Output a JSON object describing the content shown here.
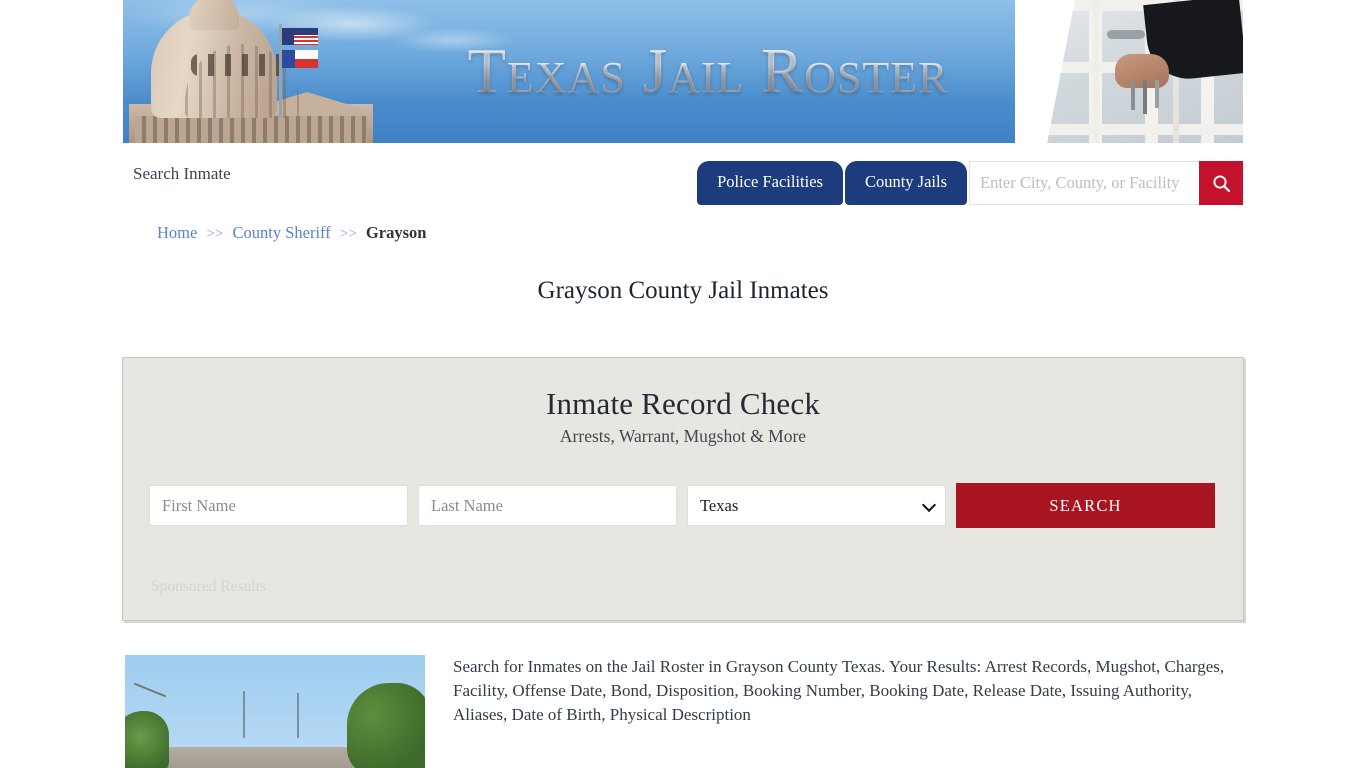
{
  "banner": {
    "title": "Texas Jail Roster",
    "left_image_alt": "texas-capitol-dome",
    "right_image_alt": "jail-cell-door-with-keys"
  },
  "nav": {
    "search_inmate_label": "Search Inmate",
    "tabs": [
      {
        "label": "Police Facilities"
      },
      {
        "label": "County Jails"
      }
    ],
    "search": {
      "value": "",
      "placeholder": "Enter City, County, or Facility",
      "button_icon": "search-icon"
    }
  },
  "breadcrumb": {
    "items": [
      {
        "label": "Home",
        "link": true
      },
      {
        "label": "County Sheriff",
        "link": true
      },
      {
        "label": "Grayson",
        "link": false
      }
    ],
    "separator": ">>"
  },
  "page_title": "Grayson County Jail Inmates",
  "record_check": {
    "heading": "Inmate Record Check",
    "subheading": "Arrests, Warrant, Mugshot & More",
    "first_name": {
      "value": "",
      "placeholder": "First Name"
    },
    "last_name": {
      "value": "",
      "placeholder": "Last Name"
    },
    "state_select": {
      "selected": "Texas",
      "options": [
        "Texas"
      ]
    },
    "search_button": "SEARCH",
    "sponsored_label": "Sponsored Results"
  },
  "content": {
    "thumbnail_alt": "grayson-county-jail-building",
    "description": "Search for Inmates on the Jail Roster in Grayson County Texas. Your Results: Arrest Records, Mugshot, Charges, Facility, Offense Date, Bond, Disposition, Booking Number, Booking Date, Release Date, Issuing Authority, Aliases, Date of Birth, Physical Description"
  },
  "colors": {
    "tab_blue": "#1d3c7e",
    "search_red": "#c4122c",
    "button_red": "#a81520",
    "panel_bg": "#e7e6e1",
    "link_blue": "#5b7fd1"
  }
}
